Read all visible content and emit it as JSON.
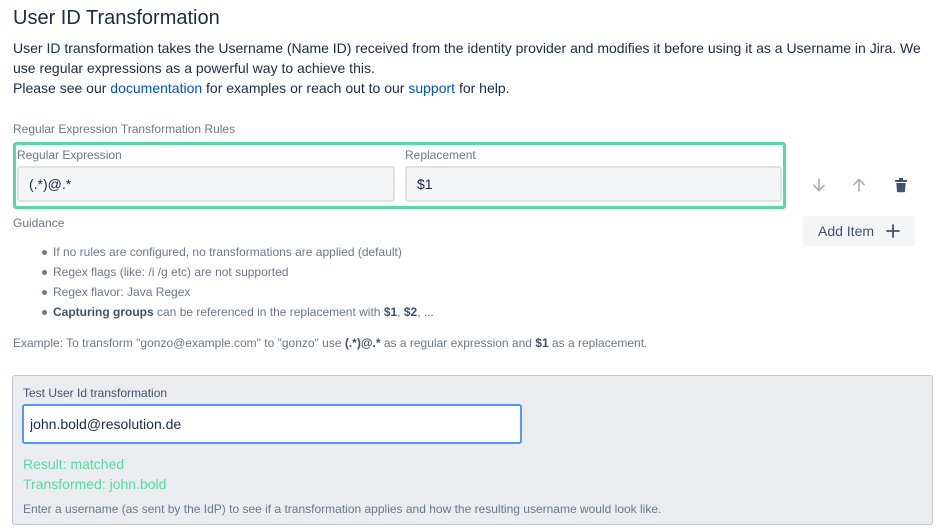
{
  "header": {
    "title": "User ID Transformation",
    "desc_line1": "User ID transformation takes the Username (Name ID) received from the identity provider and modifies it before using it as a Username in Jira. We use regular expressions as a powerful way to achieve this.",
    "desc_pre": "Please see our ",
    "doc_link": "documentation",
    "desc_mid": " for examples or reach out to our ",
    "support_link": "support",
    "desc_post": " for help."
  },
  "rules": {
    "section_label": "Regular Expression Transformation Rules",
    "regex_label": "Regular Expression",
    "replacement_label": "Replacement",
    "items": [
      {
        "regex": "(.*)@.*",
        "replacement": "$1"
      }
    ],
    "add_item_label": "Add Item"
  },
  "guidance": {
    "label": "Guidance",
    "items": [
      "If no rules are configured, no transformations are applied (default)",
      "Regex flags (like: /i /g etc) are not supported",
      "Regex flavor: Java Regex"
    ],
    "capture_bold": "Capturing groups",
    "capture_mid": " can be referenced in the replacement with ",
    "capture_d1": "$1",
    "capture_sep": ", ",
    "capture_d2": "$2",
    "capture_end": ", ..."
  },
  "example": {
    "pre": "Example: To transform \"gonzo@example.com\" to \"gonzo\" use ",
    "regex": "(.*)@.*",
    "mid": " as a regular expression and ",
    "replacement": "$1",
    "post": " as a replacement."
  },
  "test": {
    "label": "Test User Id transformation",
    "value": "john.bold@resolution.de",
    "result": "Result: matched",
    "transformed": "Transformed: john.bold",
    "hint": "Enter a username (as sent by the IdP) to see if a transformation applies and how the resulting username would look like."
  },
  "colors": {
    "accent_green": "#57d9a3",
    "link_blue": "#0052cc",
    "focus_blue": "#4c9aff"
  },
  "icons": {
    "move_down": "arrow-down-icon",
    "move_up": "arrow-up-icon",
    "delete": "trash-icon",
    "add": "plus-icon"
  }
}
